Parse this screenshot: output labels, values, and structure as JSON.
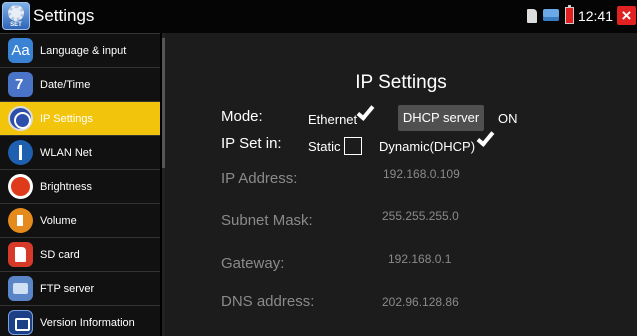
{
  "titlebar": {
    "title": "Settings",
    "app_icon_caption": "SET",
    "clock": "12:41",
    "close": "×"
  },
  "sidebar": {
    "items": [
      {
        "label": "Language & input",
        "icon": "language-icon"
      },
      {
        "label": "Date/Time",
        "icon": "calendar-icon"
      },
      {
        "label": "IP Settings",
        "icon": "globe-icon",
        "active": true
      },
      {
        "label": "WLAN Net",
        "icon": "antenna-icon"
      },
      {
        "label": "Brightness",
        "icon": "brightness-icon"
      },
      {
        "label": "Volume",
        "icon": "volume-icon"
      },
      {
        "label": "SD card",
        "icon": "sd-card-icon"
      },
      {
        "label": "FTP server",
        "icon": "ftp-icon"
      },
      {
        "label": "Version Information",
        "icon": "info-icon"
      }
    ]
  },
  "main": {
    "title": "IP Settings",
    "mode_label": "Mode:",
    "ethernet_label": "Ethernet",
    "ethernet_checked": true,
    "dhcp_server_button": "DHCP server",
    "dhcp_server_state": "ON",
    "ip_set_in_label": "IP Set in:",
    "static_label": "Static",
    "static_checked": false,
    "dynamic_label": "Dynamic(DHCP)",
    "dynamic_checked": true,
    "fields": [
      {
        "label": "IP Address:",
        "value": "192.168.0.109"
      },
      {
        "label": "Subnet Mask:",
        "value": "255.255.255.0"
      },
      {
        "label": "Gateway:",
        "value": "192.168.0.1"
      },
      {
        "label": "DNS address:",
        "value": "202.96.128.86"
      }
    ]
  },
  "colors": {
    "active_menu": "#f3c40c",
    "panel_bg": "#1c1c1c",
    "disabled_text": "#8a8a8a",
    "close_button": "#e02222"
  },
  "language_icon_text": "Aa"
}
